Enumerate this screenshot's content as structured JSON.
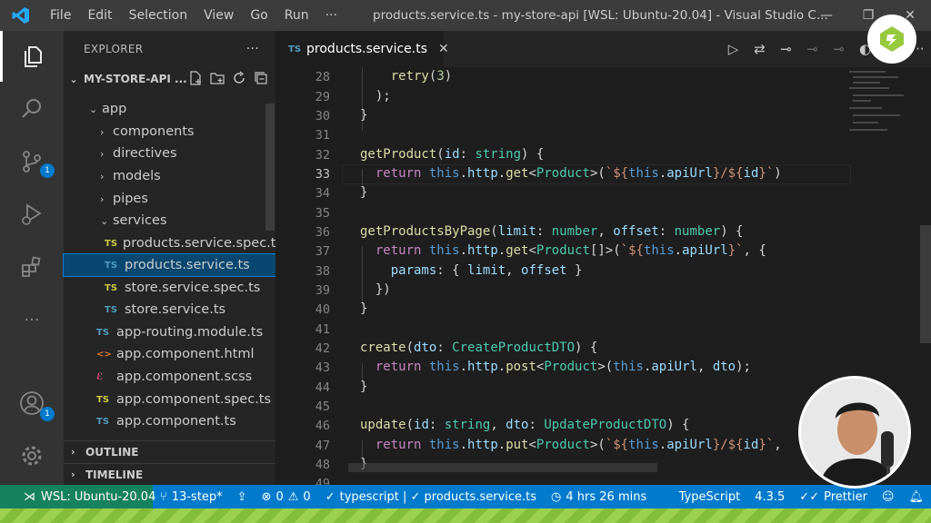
{
  "titlebar": {
    "menu": [
      "File",
      "Edit",
      "Selection",
      "View",
      "Go",
      "Run",
      "···"
    ],
    "title": "products.service.ts - my-store-api [WSL: Ubuntu-20.04] - Visual Studio C..."
  },
  "activity": {
    "items": [
      "explorer-icon",
      "search-icon",
      "source-control-icon",
      "run-debug-icon",
      "extensions-icon",
      "more-icon",
      "accounts-icon",
      "settings-icon"
    ],
    "scm_badge": "1",
    "accounts_badge": "1"
  },
  "sidebar": {
    "header": "EXPLORER",
    "header_more": "···",
    "project": "MY-STORE-API ...",
    "tree": [
      {
        "label": "app",
        "type": "folder-open",
        "indent": 1
      },
      {
        "label": "components",
        "type": "folder",
        "indent": 2
      },
      {
        "label": "directives",
        "type": "folder",
        "indent": 2
      },
      {
        "label": "models",
        "type": "folder",
        "indent": 2
      },
      {
        "label": "pipes",
        "type": "folder",
        "indent": 2
      },
      {
        "label": "services",
        "type": "folder-open",
        "indent": 2
      },
      {
        "label": "products.service.spec.ts",
        "type": "ts-spec",
        "indent": 3
      },
      {
        "label": "products.service.ts",
        "type": "ts",
        "indent": 3,
        "selected": true
      },
      {
        "label": "store.service.spec.ts",
        "type": "ts-spec",
        "indent": 3
      },
      {
        "label": "store.service.ts",
        "type": "ts",
        "indent": 3
      },
      {
        "label": "app-routing.module.ts",
        "type": "ts",
        "indent": 2
      },
      {
        "label": "app.component.html",
        "type": "html",
        "indent": 2
      },
      {
        "label": "app.component.scss",
        "type": "scss",
        "indent": 2
      },
      {
        "label": "app.component.spec.ts",
        "type": "ts-spec",
        "indent": 2
      },
      {
        "label": "app.component.ts",
        "type": "ts",
        "indent": 2
      }
    ],
    "outline": "OUTLINE",
    "timeline": "TIMELINE"
  },
  "editor": {
    "tab_icon": "TS",
    "tab_label": "products.service.ts",
    "line_numbers": [
      "28",
      "29",
      "30",
      "31",
      "32",
      "33",
      "34",
      "35",
      "36",
      "37",
      "38",
      "39",
      "40",
      "41",
      "42",
      "43",
      "44",
      "45",
      "46",
      "47",
      "48",
      "49"
    ],
    "active_line": "33"
  },
  "statusbar": {
    "remote": "WSL: Ubuntu-20.04",
    "branch": "13-step*",
    "errors": "0",
    "warnings": "0",
    "language_check": "typescript | ✓ products.service.ts",
    "time": "4 hrs 26 mins",
    "language": "TypeScript",
    "version": "4.3.5",
    "prettier": "Prettier"
  },
  "colors": {
    "accent": "#007acc",
    "remote": "#16825d",
    "selection": "#094771"
  }
}
